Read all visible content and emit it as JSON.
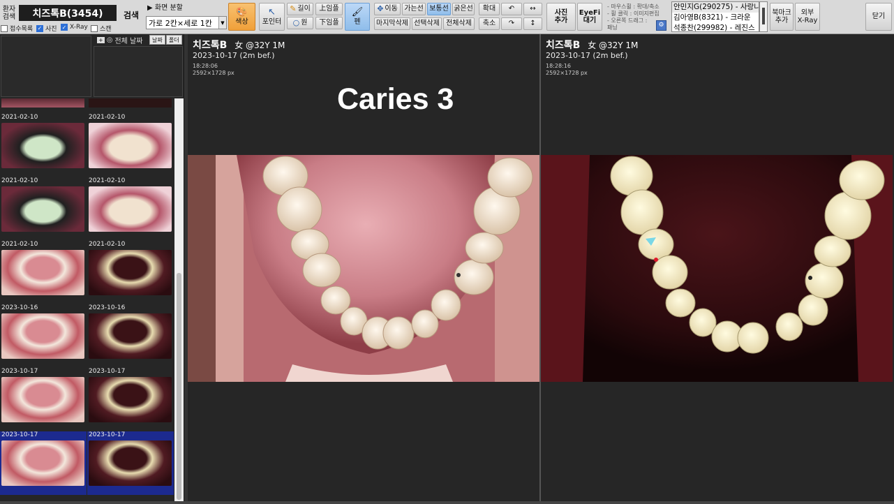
{
  "toolbar": {
    "patient_search_label": "환자\n검색",
    "patient_name": "치즈톡B(3454)",
    "search_button": "검색",
    "checkboxes": [
      {
        "label": "접수목록",
        "checked": false
      },
      {
        "label": "사진",
        "checked": true
      },
      {
        "label": "X-Ray",
        "checked": true
      },
      {
        "label": "스캔",
        "checked": false
      }
    ],
    "split_title": "▶ 화면 분할",
    "split_value": "가로 2칸×세로 1칸",
    "color_button": "색상",
    "pointer_button": "포인터",
    "length_button": "길이",
    "circle_button": "원",
    "upper_jaw_button": "上임플",
    "lower_jaw_button": "下임플",
    "pen_button": "펜",
    "move_button": "이동",
    "thin_line_button": "가는선",
    "normal_line_button": "보통선",
    "thick_line_button": "굵은선",
    "delete_last_button": "마지막삭제",
    "delete_selected_button": "선택삭제",
    "delete_all_button": "전체삭제",
    "zoom_in_button": "확대",
    "zoom_out_button": "축소",
    "rotate_left_button": "↶",
    "rotate_right_button": "↷",
    "flip_h_button": "↔",
    "flip_v_button": "↕",
    "add_photo_button": "사진\n추가",
    "eyefi_button": "EyeFi\n대기",
    "help_lines": [
      "- 마우스휠 : 확대/축소",
      "- 휠 클릭 : 이미지편집",
      "- 오른쪽 드래그 :",
      "  패닝"
    ],
    "patient_list": [
      "안민지G(290275) - 사랑니",
      "김아영B(8321) - 크라운",
      "석종찬(299982) - 레진스"
    ],
    "bookmark_button": "북마크\n추가",
    "external_xray_button": "외부\nX-Ray",
    "close_button": "닫기"
  },
  "left_panel": {
    "all_dates_label": "전체 날짜",
    "date_tag": "날짜",
    "folder_tag": "폴더",
    "thumbnails": [
      {
        "date": "2021-02-10",
        "style": "occlusal-front-dark"
      },
      {
        "date": "2021-02-10",
        "style": "front-light"
      },
      {
        "date": "2021-02-10",
        "style": "occlusal-front-dark"
      },
      {
        "date": "2021-02-10",
        "style": "front-light"
      },
      {
        "date": "2021-02-10",
        "style": "arch-light"
      },
      {
        "date": "2021-02-10",
        "style": "arch-dark"
      },
      {
        "date": "2023-10-16",
        "style": "arch-light"
      },
      {
        "date": "2023-10-16",
        "style": "arch-dark"
      },
      {
        "date": "2023-10-17",
        "style": "arch-light"
      },
      {
        "date": "2023-10-17",
        "style": "arch-dark"
      },
      {
        "date": "2023-10-17",
        "style": "arch-light"
      },
      {
        "date": "2023-10-17",
        "style": "arch-dark"
      }
    ]
  },
  "viewers": [
    {
      "patient": "치즈톡B",
      "info": "女 @32Y 1M",
      "date": "2023-10-17 (2m bef.)",
      "time": "18:28:06",
      "size": "2592×1728 px",
      "overlay": "Caries 3"
    },
    {
      "patient": "치즈톡B",
      "info": "女 @32Y 1M",
      "date": "2023-10-17 (2m bef.)",
      "time": "18:28:16",
      "size": "2592×1728 px",
      "overlay": ""
    }
  ],
  "colors": {
    "accent_orange": "#f2a33a",
    "accent_blue": "#8fbdea",
    "background": "#262626"
  }
}
